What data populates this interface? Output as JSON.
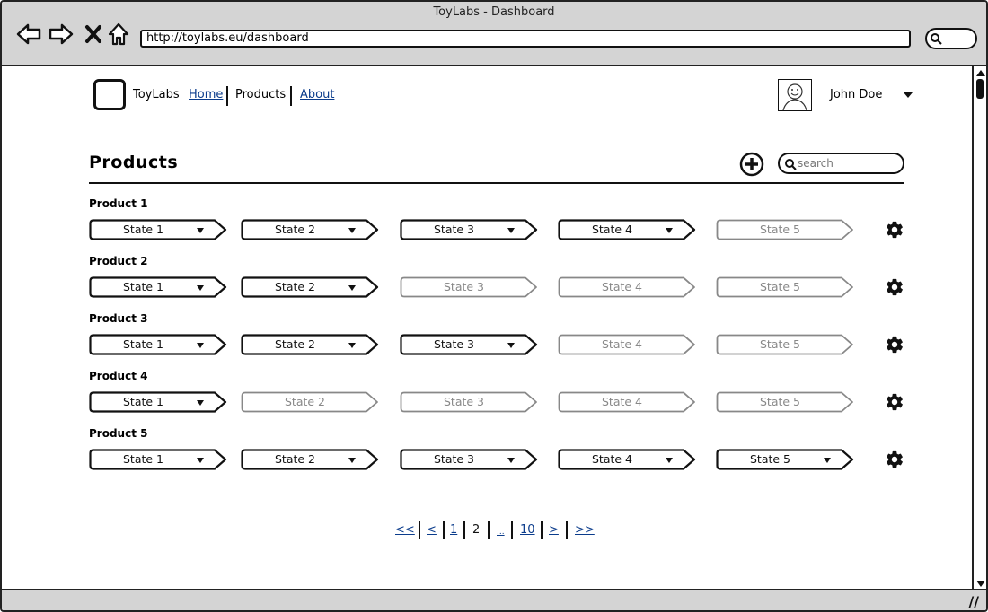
{
  "window": {
    "title": "ToyLabs - Dashboard"
  },
  "browser": {
    "url": "http://toylabs.eu/dashboard"
  },
  "nav": {
    "brand": "ToyLabs",
    "links": [
      "Home",
      "Products",
      "About"
    ],
    "user_name": "John Doe"
  },
  "main": {
    "title": "Products",
    "search_placeholder": "search"
  },
  "products": [
    {
      "name": "Product 1",
      "states": [
        {
          "label": "State 1",
          "active": true
        },
        {
          "label": "State 2",
          "active": true
        },
        {
          "label": "State 3",
          "active": true
        },
        {
          "label": "State 4",
          "active": true
        },
        {
          "label": "State 5",
          "active": false
        }
      ]
    },
    {
      "name": "Product 2",
      "states": [
        {
          "label": "State 1",
          "active": true
        },
        {
          "label": "State 2",
          "active": true
        },
        {
          "label": "State 3",
          "active": false
        },
        {
          "label": "State 4",
          "active": false
        },
        {
          "label": "State 5",
          "active": false
        }
      ]
    },
    {
      "name": "Product 3",
      "states": [
        {
          "label": "State 1",
          "active": true
        },
        {
          "label": "State 2",
          "active": true
        },
        {
          "label": "State 3",
          "active": true
        },
        {
          "label": "State 4",
          "active": false
        },
        {
          "label": "State 5",
          "active": false
        }
      ]
    },
    {
      "name": "Product 4",
      "states": [
        {
          "label": "State 1",
          "active": true
        },
        {
          "label": "State 2",
          "active": false
        },
        {
          "label": "State 3",
          "active": false
        },
        {
          "label": "State 4",
          "active": false
        },
        {
          "label": "State 5",
          "active": false
        }
      ]
    },
    {
      "name": "Product 5",
      "states": [
        {
          "label": "State 1",
          "active": true
        },
        {
          "label": "State 2",
          "active": true
        },
        {
          "label": "State 3",
          "active": true
        },
        {
          "label": "State 4",
          "active": true
        },
        {
          "label": "State 5",
          "active": true
        }
      ]
    }
  ],
  "pagination": {
    "items": [
      {
        "label": "<<",
        "type": "link"
      },
      {
        "label": "<",
        "type": "link"
      },
      {
        "label": "1",
        "type": "link"
      },
      {
        "label": "2",
        "type": "current"
      },
      {
        "label": "...",
        "type": "link"
      },
      {
        "label": "10",
        "type": "link"
      },
      {
        "label": ">",
        "type": "link"
      },
      {
        "label": ">>",
        "type": "link"
      }
    ]
  },
  "icons": {
    "back": "back-arrow-icon",
    "forward": "forward-arrow-icon",
    "stop": "close-icon",
    "home": "home-icon",
    "search": "search-icon",
    "add": "plus-circle-icon",
    "settings": "gear-icon",
    "avatar": "user-avatar-icon",
    "dropdown": "chevron-down-icon"
  },
  "colors": {
    "active_text": "#111111",
    "inactive_text": "#888888",
    "link": "#0b3c8c",
    "chrome": "#d4d4d4"
  }
}
